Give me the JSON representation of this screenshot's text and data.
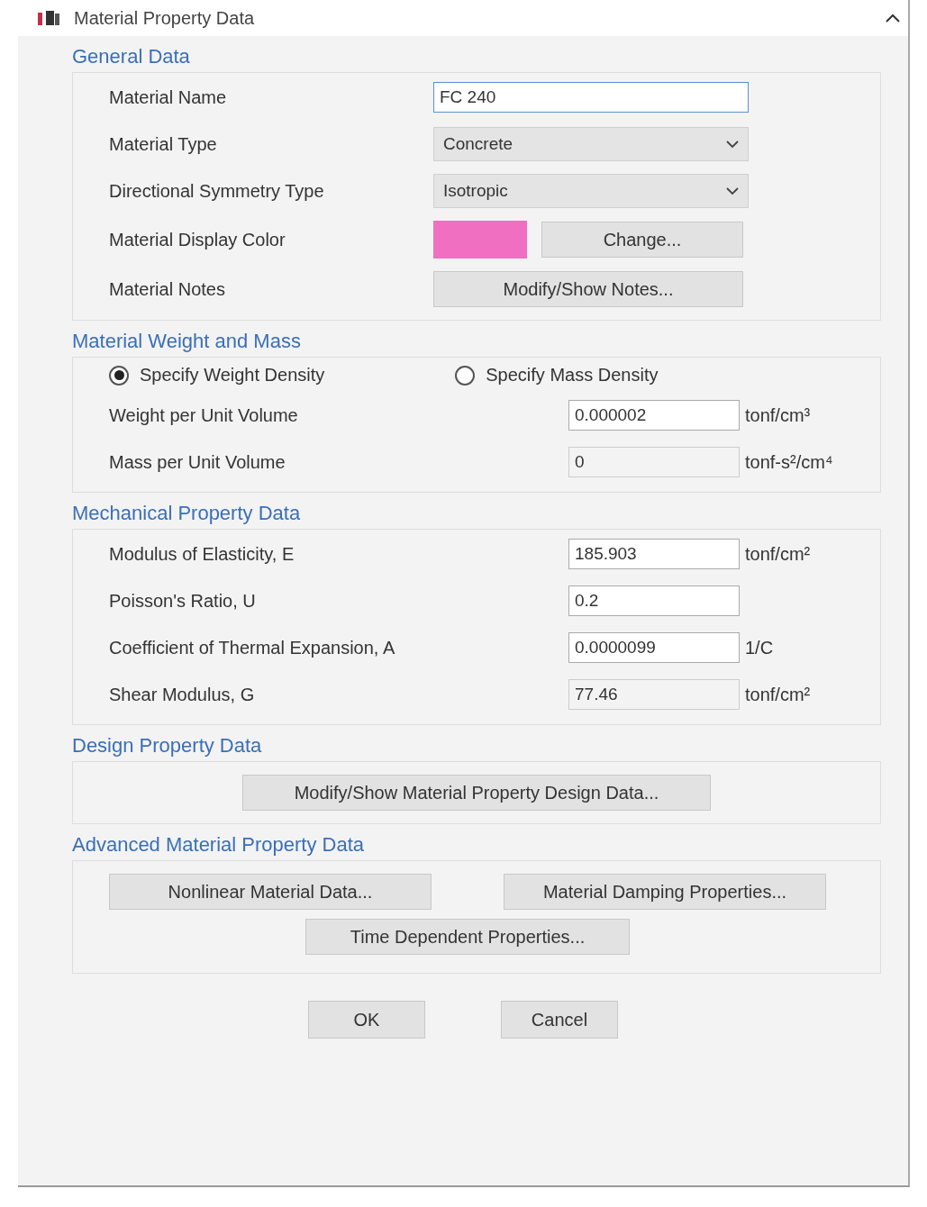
{
  "window": {
    "title": "Material Property Data"
  },
  "general": {
    "title": "General Data",
    "rows": [
      {
        "kind": "text",
        "label": "Material Name",
        "value": "FC 240"
      },
      {
        "kind": "combo",
        "label": "Material Type",
        "value": "Concrete"
      },
      {
        "kind": "combo",
        "label": "Directional Symmetry Type",
        "value": "Isotropic"
      },
      {
        "kind": "color",
        "label": "Material Display Color",
        "color": "#f06fc0",
        "button": "Change..."
      },
      {
        "kind": "button",
        "label": "Material Notes",
        "button": "Modify/Show Notes..."
      }
    ]
  },
  "weight": {
    "title": "Material Weight and Mass",
    "options": [
      {
        "label": "Specify Weight Density",
        "selected": true
      },
      {
        "label": "Specify Mass Density",
        "selected": false
      }
    ],
    "rows": [
      {
        "label": "Weight per Unit Volume",
        "value": "0.000002",
        "unit": "tonf/cm³",
        "disabled": false
      },
      {
        "label": "Mass per Unit Volume",
        "value": "0",
        "unit": "tonf-s²/cm⁴",
        "disabled": true
      }
    ]
  },
  "mechanical": {
    "title": "Mechanical Property Data",
    "rows": [
      {
        "label": "Modulus of Elasticity,  E",
        "value": "185.903",
        "unit": "tonf/cm²",
        "disabled": false
      },
      {
        "label": "Poisson's Ratio,  U",
        "value": "0.2",
        "unit": "",
        "disabled": false
      },
      {
        "label": "Coefficient of Thermal Expansion,  A",
        "value": "0.0000099",
        "unit": "1/C",
        "disabled": false
      },
      {
        "label": "Shear Modulus,  G",
        "value": "77.46",
        "unit": "tonf/cm²",
        "disabled": true
      }
    ]
  },
  "design": {
    "title": "Design Property Data",
    "button": "Modify/Show Material Property Design Data..."
  },
  "advanced": {
    "title": "Advanced Material Property Data",
    "buttons": [
      "Nonlinear Material Data...",
      "Material Damping Properties...",
      "Time Dependent Properties..."
    ]
  },
  "buttons": [
    "OK",
    "Cancel"
  ]
}
